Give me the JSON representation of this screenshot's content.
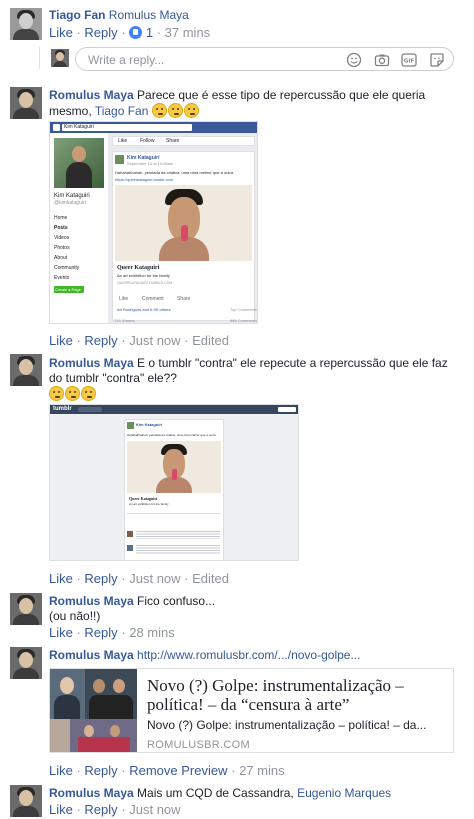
{
  "colors": {
    "link": "#365899",
    "muted": "#90949c",
    "fb_blue": "#3b5998",
    "tumblr_navy": "#36465d"
  },
  "comment1": {
    "author": "Tiago Fan",
    "text": "Romulus Maya",
    "actions": {
      "like": "Like",
      "reply": "Reply",
      "like_count": "1",
      "time": "37 mins"
    }
  },
  "reply_box": {
    "placeholder": "Write a reply...",
    "icons": [
      "emoji-icon",
      "camera-icon",
      "gif-icon",
      "sticker-icon"
    ]
  },
  "comment2": {
    "author": "Romulus Maya",
    "text_line1": "Parece que é esse tipo de repercussão que ele queria",
    "text_line2": "mesmo,",
    "mention": "Tiago Fan",
    "actions": {
      "like": "Like",
      "reply": "Reply",
      "time": "Just now",
      "edited": "Edited"
    },
    "screenshot": {
      "search_value": "Kim Kataguiri",
      "profile_name": "Kim Kataguiri",
      "profile_handle": "@kimkataguiri",
      "nav": [
        "Home",
        "Posts",
        "Videos",
        "Photos",
        "About",
        "Community",
        "Events"
      ],
      "create_page": "Create a Page",
      "post_author": "Kim Kataguiri",
      "post_time": "September 14 at 10:06am ·",
      "post_text": "Hahahahhahah, pelotada da criativa, uma obra melhor que a outra",
      "post_link": "https://queerkataguiri.tumblr.com",
      "card_title": "Queer Kataguiri",
      "card_desc": "An art exhibition for the family",
      "card_domain": "QUEERKATAGUIRI.TUMBLR.COM",
      "like": "Like",
      "comment": "Comment",
      "share": "Share",
      "reactions": "Ari Rodrigues and 6.9K others",
      "top_comments": "Top Comments",
      "shares": "715 Shares",
      "comments_count": "886 Comments",
      "tabs": [
        "Like",
        "Follow",
        "Share"
      ]
    }
  },
  "comment3": {
    "author": "Romulus Maya",
    "text_line1": "E o tumblr \"contra\" ele repecute a repercussão que ele faz",
    "text_line2": "do tumblr \"contra\" ele??",
    "actions": {
      "like": "Like",
      "reply": "Reply",
      "time": "Just now",
      "edited": "Edited"
    },
    "screenshot": {
      "logo": "tumblr",
      "post_author": "Kim Kataguiri",
      "post_text": "Hahahahhahah, pelotada da criativa, uma obra melhor que a outra",
      "card_title": "Queer Kataguiri",
      "card_desc": "An art exhibition for the family"
    }
  },
  "comment4": {
    "author": "Romulus Maya",
    "text_line1": "Fico confuso...",
    "text_line2": "(ou não!!)",
    "actions": {
      "like": "Like",
      "reply": "Reply",
      "time": "28 mins"
    }
  },
  "comment5": {
    "author": "Romulus Maya",
    "link": "http://www.romulusbr.com/.../novo-golpe...",
    "preview": {
      "title": "Novo (?) Golpe: instrumentalização – política! – da “censura à arte”",
      "description": "Novo (?) Golpe: instrumentalização – política! – da...",
      "domain": "ROMULUSBR.COM"
    },
    "actions": {
      "like": "Like",
      "reply": "Reply",
      "remove_preview": "Remove Preview",
      "time": "27 mins"
    }
  },
  "comment6": {
    "author": "Romulus Maya",
    "text": "Mais um CQD de Cassandra,",
    "mention": "Eugenio Marques",
    "actions": {
      "like": "Like",
      "reply": "Reply",
      "time": "Just now"
    }
  }
}
